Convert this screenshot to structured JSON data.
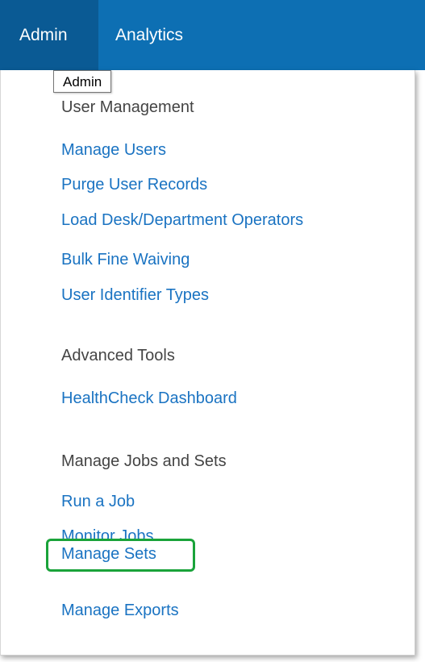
{
  "topbar": {
    "tabs": [
      {
        "label": "Admin"
      },
      {
        "label": "Analytics"
      }
    ]
  },
  "tooltip": {
    "text": "Admin"
  },
  "menu": {
    "sections": [
      {
        "heading": "User Management",
        "items": [
          "Manage Users",
          "Purge User Records",
          "Load Desk/Department Operators",
          "Bulk Fine Waiving",
          "User Identifier Types"
        ]
      },
      {
        "heading": "Advanced Tools",
        "items": [
          "HealthCheck Dashboard"
        ]
      },
      {
        "heading": "Manage Jobs and Sets",
        "items": [
          "Run a Job",
          "Monitor Jobs",
          "Manage Sets",
          "Manage Exports"
        ]
      }
    ]
  },
  "colors": {
    "topbar": "#0d6fb3",
    "active_tab": "#0a5a94",
    "link": "#1a73c2",
    "heading": "#444444",
    "highlight": "#1aa33a"
  }
}
